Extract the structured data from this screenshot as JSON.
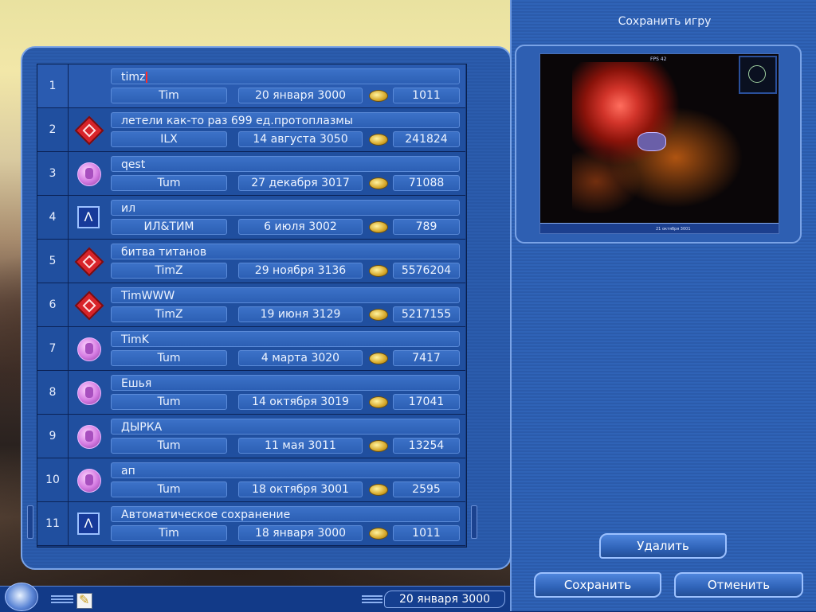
{
  "window": {
    "title": "Сохранить игру"
  },
  "buttons": {
    "delete": "Удалить",
    "save": "Сохранить",
    "cancel": "Отменить"
  },
  "status_bar": {
    "date": "20 января 3000"
  },
  "saves": [
    {
      "num": "1",
      "icon": "none",
      "name": "timz",
      "author": "Tim",
      "date": "20 января 3000",
      "score": "1011",
      "selected": true
    },
    {
      "num": "2",
      "icon": "red-diamond-icon",
      "name": "летели как-то раз 699 ед.протоплазмы",
      "author": "ILX",
      "date": "14 августа 3050",
      "score": "241824"
    },
    {
      "num": "3",
      "icon": "pink-orb-icon",
      "name": "qest",
      "author": "Tum",
      "date": "27 декабря 3017",
      "score": "71088"
    },
    {
      "num": "4",
      "icon": "blue-lambda-icon",
      "name": "ил",
      "author": "ИЛ&ТИМ",
      "date": "6 июля 3002",
      "score": "789"
    },
    {
      "num": "5",
      "icon": "red-diamond-icon",
      "name": "битва титанов",
      "author": "TimZ",
      "date": "29 ноября 3136",
      "score": "5576204"
    },
    {
      "num": "6",
      "icon": "red-diamond-icon",
      "name": "TimWWW",
      "author": "TimZ",
      "date": "19 июня 3129",
      "score": "5217155"
    },
    {
      "num": "7",
      "icon": "pink-orb-icon",
      "name": "TimK",
      "author": "Tum",
      "date": "4 марта 3020",
      "score": "7417"
    },
    {
      "num": "8",
      "icon": "pink-orb-icon",
      "name": "Ешья",
      "author": "Tum",
      "date": "14 октября 3019",
      "score": "17041"
    },
    {
      "num": "9",
      "icon": "pink-orb-icon",
      "name": "ДЫРКА",
      "author": "Tum",
      "date": "11 мая 3011",
      "score": "13254"
    },
    {
      "num": "10",
      "icon": "pink-orb-icon",
      "name": "ап",
      "author": "Tum",
      "date": "18 октября 3001",
      "score": "2595"
    },
    {
      "num": "11",
      "icon": "blue-lambda-icon",
      "name": "Автоматическое сохранение",
      "author": "Tim",
      "date": "18 января 3000",
      "score": "1011"
    }
  ],
  "preview": {
    "fps": "FPS 42",
    "hud_date": "21 октября 3001"
  }
}
